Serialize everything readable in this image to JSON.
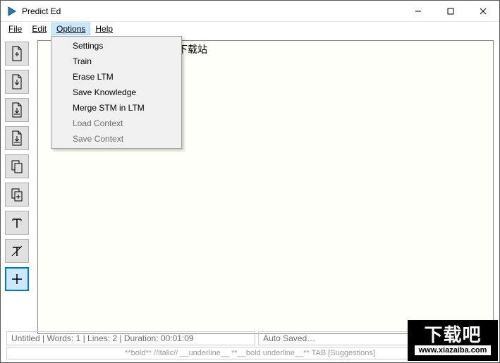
{
  "window": {
    "title": "Predict Ed",
    "minimize": "–",
    "maximize": "☐",
    "close": "✕"
  },
  "menubar": {
    "file": "File",
    "edit": "Edit",
    "options": "Options",
    "help": "Help"
  },
  "options_menu": {
    "settings": "Settings",
    "train": "Train",
    "erase_ltm": "Erase LTM",
    "save_knowledge": "Save Knowledge",
    "merge_stm": "Merge STM in LTM",
    "load_context": "Load Context",
    "save_context": "Save Context"
  },
  "editor": {
    "content_fragment": "勺下载站"
  },
  "toolbar": {
    "new_doc": "new-document",
    "open_doc": "open-document",
    "save_doc": "save-document",
    "export_doc": "export-document",
    "copy": "copy",
    "copy_plus": "copy-plus",
    "text_field": "text-insert",
    "clear_format": "clear-format",
    "crosshair": "add-cursor"
  },
  "status": {
    "left": "Untitled | Words: 1 | Lines: 2 | Duration: 00:01:09",
    "right": "Auto Saved…"
  },
  "hints": {
    "text": "**bold**  //italic//  __underline__  **__bold underline__**  TAB [Suggestions]"
  },
  "watermark": {
    "text": "下载吧",
    "url": "www.xiazaiba.com"
  }
}
